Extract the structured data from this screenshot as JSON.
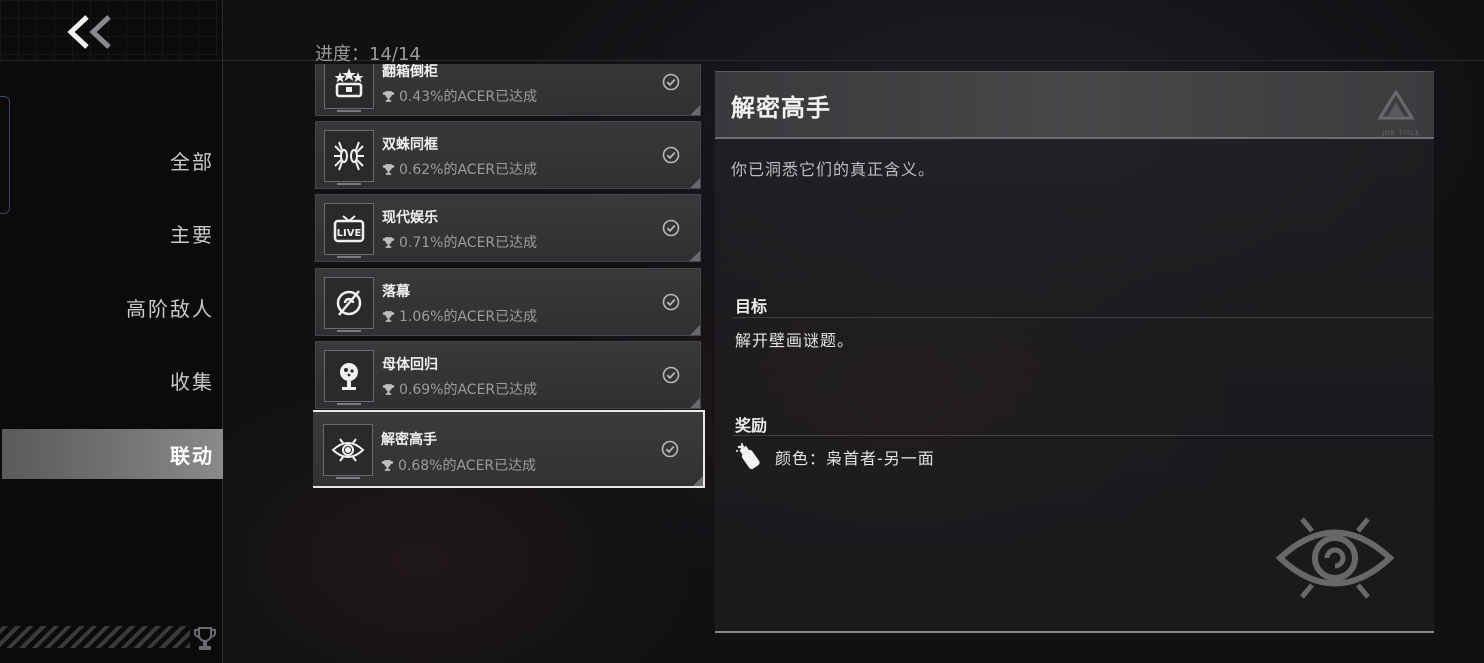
{
  "sidebar": {
    "back_label": "<<",
    "nav_items": [
      {
        "label": "全部",
        "active": false
      },
      {
        "label": "主要",
        "active": false
      },
      {
        "label": "高阶敌人",
        "active": false
      },
      {
        "label": "收集",
        "active": false
      },
      {
        "label": "联动",
        "active": true
      }
    ],
    "footer_icon": "trophy-icon"
  },
  "progress": {
    "text": "进度：14/14"
  },
  "achievements": [
    {
      "title": "翻箱倒柜",
      "percent_text": "0.43%的ACER已达成",
      "icon": "chest-stars-icon",
      "completed": true
    },
    {
      "title": "双蛛同框",
      "percent_text": "0.62%的ACER已达成",
      "icon": "twin-spider-icon",
      "completed": true
    },
    {
      "title": "现代娱乐",
      "percent_text": "0.71%的ACER已达成",
      "icon": "live-tv-icon",
      "completed": true
    },
    {
      "title": "落幕",
      "percent_text": "1.06%的ACER已达成",
      "icon": "slashed-circle-icon",
      "completed": true
    },
    {
      "title": "母体回归",
      "percent_text": "0.69%的ACER已达成",
      "icon": "motherbrain-icon",
      "completed": true
    },
    {
      "title": "解密高手",
      "percent_text": "0.68%的ACER已达成",
      "icon": "eye-emblem-icon",
      "completed": true,
      "selected": true
    }
  ],
  "detail": {
    "title": "解密高手",
    "header_small_text": "JOB TITLE",
    "description": "你已洞悉它们的真正含义。",
    "goal_label": "目标",
    "goal_text": "解开壁画谜题。",
    "reward_label": "奖励",
    "reward_icon": "spray-can-icon",
    "reward_text": "颜色：枭首者-另一面",
    "emblem": "eye-emblem-icon"
  },
  "colors": {
    "background": "#111114",
    "active_nav": "#767677",
    "card": "#36363a",
    "selected_border": "#e9e9e9"
  }
}
